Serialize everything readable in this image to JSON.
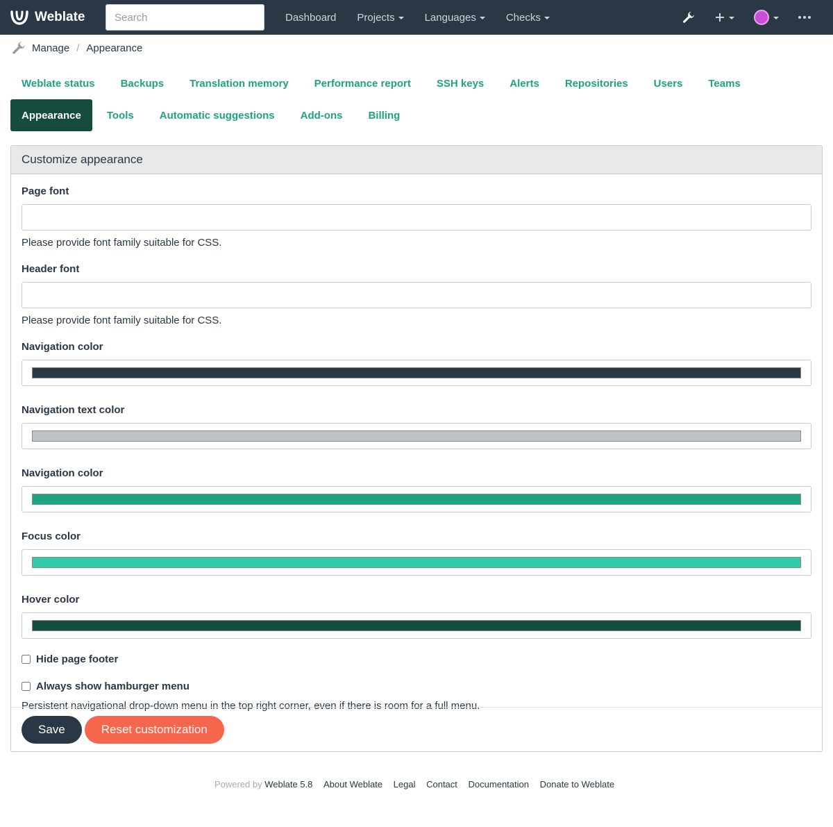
{
  "navbar": {
    "brand": "Weblate",
    "search_placeholder": "Search",
    "links": [
      "Dashboard",
      "Projects",
      "Languages",
      "Checks"
    ],
    "bg_color": "#2a3744"
  },
  "breadcrumb": {
    "manage": "Manage",
    "sep": "/",
    "current": "Appearance"
  },
  "tabs": [
    "Weblate status",
    "Backups",
    "Translation memory",
    "Performance report",
    "SSH keys",
    "Alerts",
    "Repositories",
    "Users",
    "Teams",
    "Appearance",
    "Tools",
    "Automatic suggestions",
    "Add-ons",
    "Billing"
  ],
  "active_tab": "Appearance",
  "panel": {
    "title": "Customize appearance",
    "page_font": {
      "label": "Page font",
      "value": "",
      "help": "Please provide font family suitable for CSS."
    },
    "header_font": {
      "label": "Header font",
      "value": "",
      "help": "Please provide font family suitable for CSS."
    },
    "colors": [
      {
        "label": "Navigation color",
        "value": "#2a3744"
      },
      {
        "label": "Navigation text color",
        "value": "#bfc3c7"
      },
      {
        "label": "Navigation color",
        "value": "#1fa385"
      },
      {
        "label": "Focus color",
        "value": "#2eccaa"
      },
      {
        "label": "Hover color",
        "value": "#144d3f"
      }
    ],
    "hide_footer": {
      "label": "Hide page footer",
      "checked": false
    },
    "hamburger": {
      "label": "Always show hamburger menu",
      "checked": false,
      "help": "Persistent navigational drop-down menu in the top right corner, even if there is room for a full menu."
    },
    "save_label": "Save",
    "reset_label": "Reset customization"
  },
  "footer": {
    "powered_by": "Powered by",
    "links": [
      "Weblate 5.8",
      "About Weblate",
      "Legal",
      "Contact",
      "Documentation",
      "Donate to Weblate"
    ]
  }
}
